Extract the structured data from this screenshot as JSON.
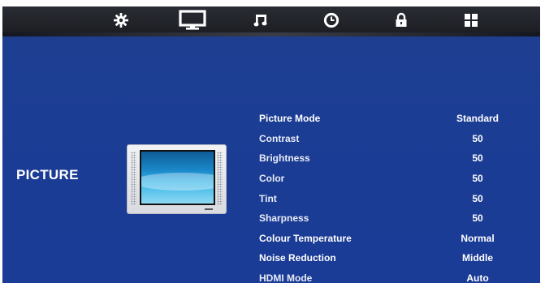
{
  "topbar": {
    "icons": [
      {
        "name": "picture-settings-gear-icon"
      },
      {
        "name": "monitor-icon",
        "selected": true
      },
      {
        "name": "music-note-icon"
      },
      {
        "name": "clock-icon"
      },
      {
        "name": "lock-icon"
      },
      {
        "name": "grid-icon"
      }
    ]
  },
  "section": {
    "title": "PICTURE"
  },
  "settings": [
    {
      "label": "Picture Mode",
      "value": "Standard"
    },
    {
      "label": "Contrast",
      "value": "50"
    },
    {
      "label": "Brightness",
      "value": "50"
    },
    {
      "label": "Color",
      "value": "50"
    },
    {
      "label": "Tint",
      "value": "50"
    },
    {
      "label": "Sharpness",
      "value": "50"
    },
    {
      "label": "Colour Temperature",
      "value": "Normal"
    },
    {
      "label": "Noise Reduction",
      "value": "Middle"
    },
    {
      "label": "HDMI Mode",
      "value": "Auto"
    }
  ],
  "colors": {
    "background": "#1b3d94",
    "topbar": "#22242b",
    "text": "#ffffff"
  }
}
